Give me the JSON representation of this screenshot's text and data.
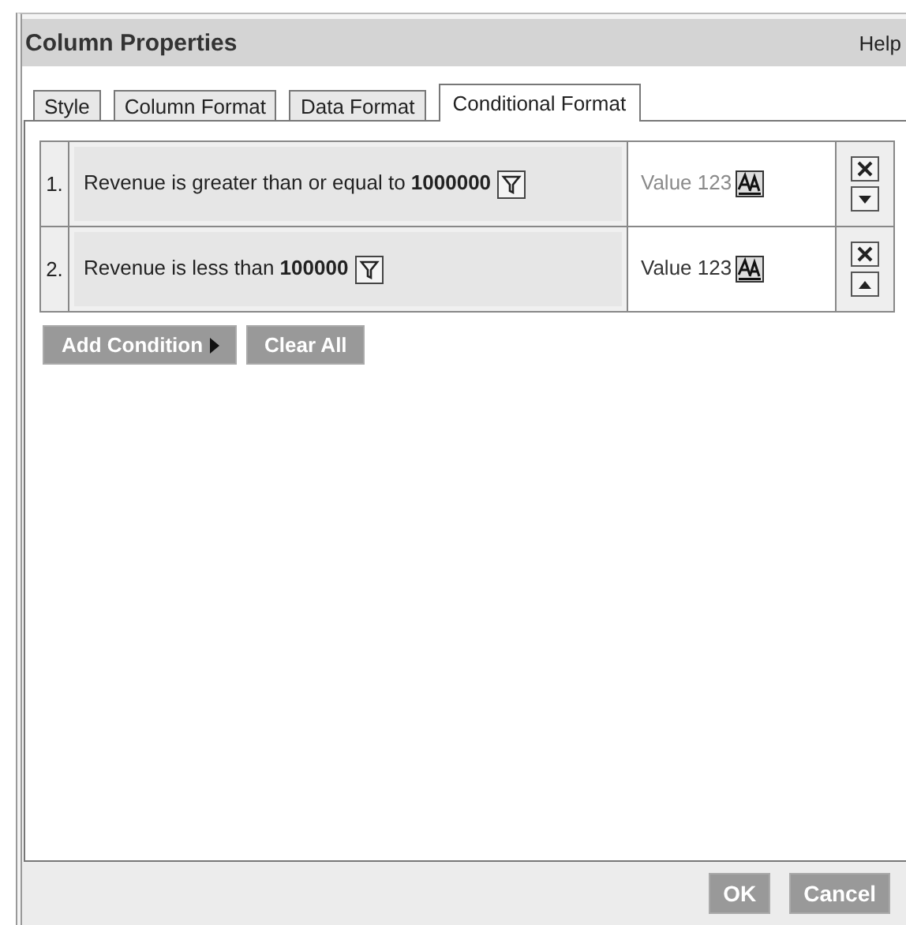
{
  "window": {
    "title": "Column Properties",
    "help": "Help"
  },
  "tabs": [
    {
      "label": "Style",
      "selected": false
    },
    {
      "label": "Column Format",
      "selected": false
    },
    {
      "label": "Data Format",
      "selected": false
    },
    {
      "label": "Conditional Format",
      "selected": true
    }
  ],
  "conditions": [
    {
      "number": "1.",
      "text": "Revenue is greater than or equal to **1000000**",
      "preview": "Value 123",
      "color": "#8a8a8a",
      "kind": "move-down"
    },
    {
      "number": "2.",
      "text": "Revenue is less than **100000**",
      "preview": "Value 123",
      "color": "#333333",
      "kind": "move-up"
    }
  ],
  "actions": [
    {
      "label": "Add Condition",
      "kind": "menu"
    },
    {
      "label": "Clear All",
      "kind": "plain"
    }
  ],
  "buttons": [
    "OK",
    "Cancel"
  ]
}
